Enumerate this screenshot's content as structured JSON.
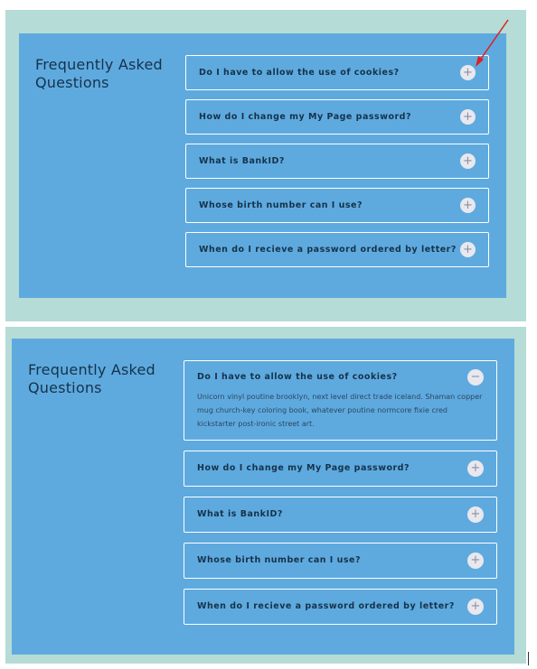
{
  "title": "Frequently Asked Questions",
  "collapsed_view": {
    "toggle_symbol": "+",
    "items": [
      {
        "question": "Do I have to allow the use of cookies?"
      },
      {
        "question": "How do I change my My Page password?"
      },
      {
        "question": "What is BankID?"
      },
      {
        "question": "Whose birth number can I use?"
      },
      {
        "question": "When do I recieve a password ordered by letter?"
      }
    ]
  },
  "expanded_view": {
    "open_item": {
      "question": "Do I have to allow the use of cookies?",
      "answer": "Unicorn vinyl poutine brooklyn, next level direct trade iceland. Shaman copper mug church-key coloring book, whatever poutine normcore fixie cred kickstarter post-ironic street art.",
      "toggle_symbol": "−"
    },
    "toggle_symbol": "+",
    "items": [
      {
        "question": "How do I change my My Page password?"
      },
      {
        "question": "What is BankID?"
      },
      {
        "question": "Whose birth number can I use?"
      },
      {
        "question": "When do I recieve a password ordered by letter?"
      }
    ]
  },
  "colors": {
    "panel_bg": "#b5dcd6",
    "card_bg": "#5eaadf",
    "text_dark": "#16324a",
    "border": "#ffffff",
    "annotation_arrow": "#e11d1d"
  }
}
